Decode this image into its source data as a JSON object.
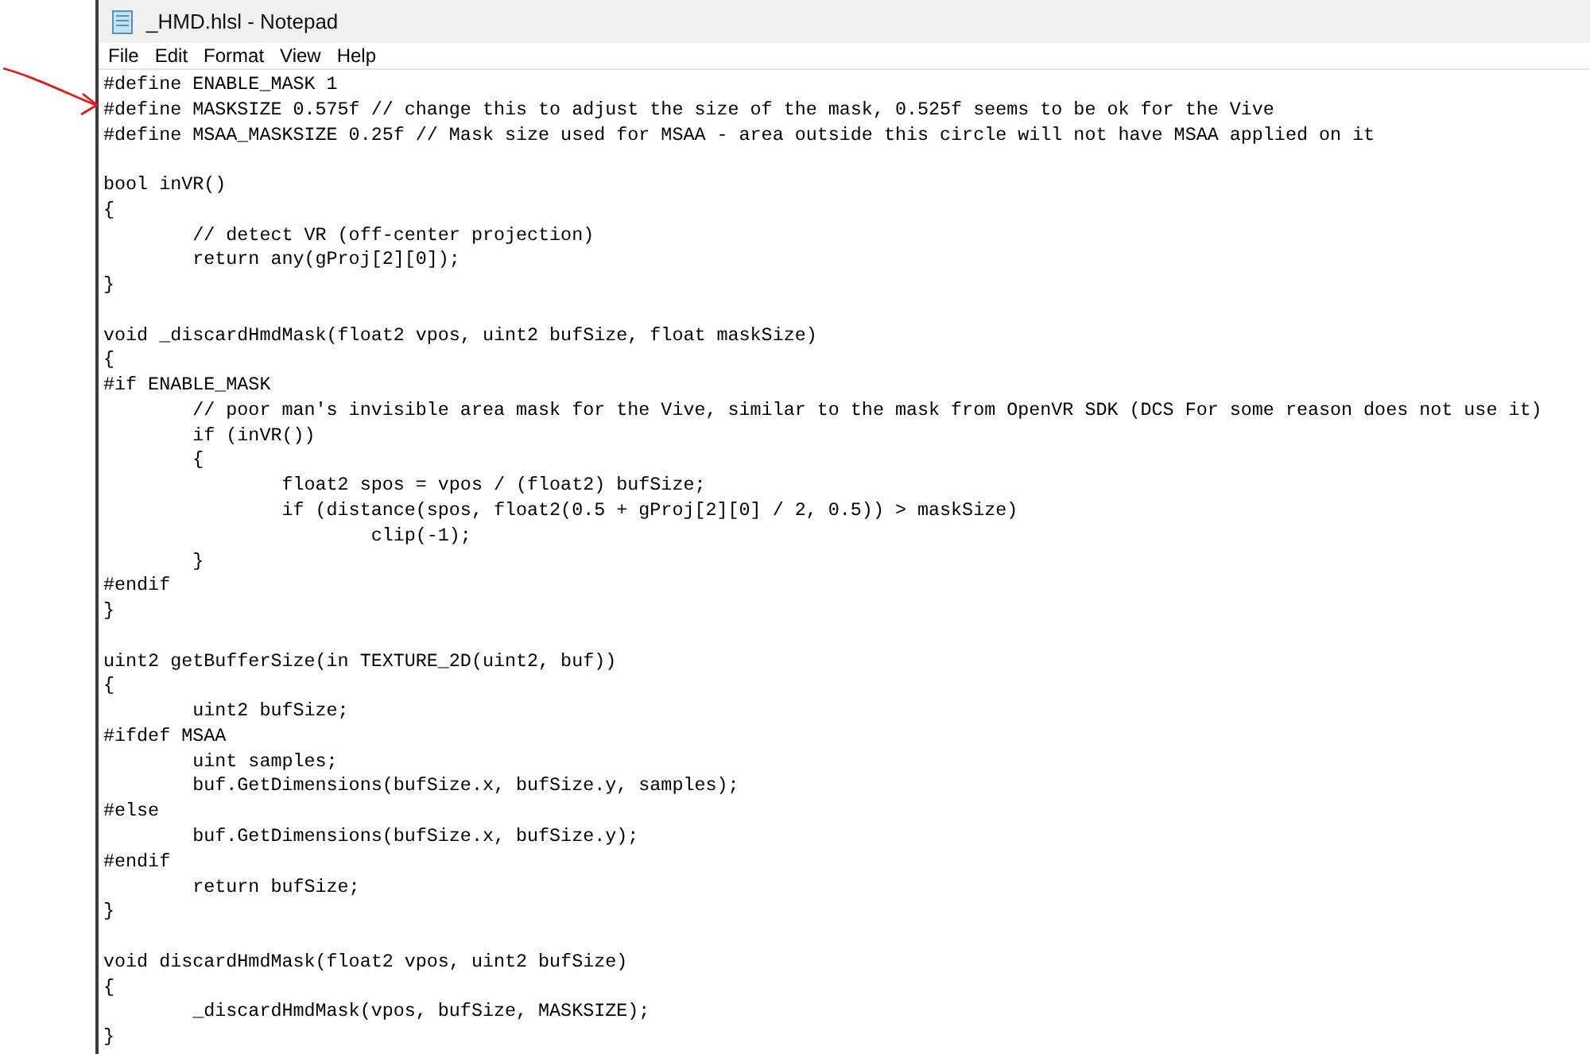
{
  "window": {
    "title": "_HMD.hlsl - Notepad"
  },
  "menu": [
    "File",
    "Edit",
    "Format",
    "View",
    "Help"
  ],
  "code_blocks": [
    [
      "#define ENABLE_MASK 1",
      "#define MASKSIZE 0.575f // change this to adjust the size of the mask, 0.525f seems to be ok for the Vive",
      "#define MSAA_MASKSIZE 0.25f // Mask size used for MSAA - area outside this circle will not have MSAA applied on it"
    ],
    [
      "bool inVR()",
      "{",
      "\t// detect VR (off-center projection)",
      "\treturn any(gProj[2][0]);",
      "}"
    ],
    [
      "void _discardHmdMask(float2 vpos, uint2 bufSize, float maskSize)",
      "{",
      "#if ENABLE_MASK",
      "\t// poor man's invisible area mask for the Vive, similar to the mask from OpenVR SDK (DCS For some reason does not use it)",
      "\tif (inVR())",
      "\t{",
      "\t\tfloat2 spos = vpos / (float2) bufSize;",
      "\t\tif (distance(spos, float2(0.5 + gProj[2][0] / 2, 0.5)) > maskSize)",
      "\t\t\tclip(-1);",
      "\t}",
      "#endif",
      "}"
    ],
    [
      "uint2 getBufferSize(in TEXTURE_2D(uint2, buf))",
      "{",
      "\tuint2 bufSize;",
      "#ifdef MSAA",
      "\tuint samples;",
      "\tbuf.GetDimensions(bufSize.x, bufSize.y, samples);",
      "#else",
      "\tbuf.GetDimensions(bufSize.x, bufSize.y);",
      "#endif",
      "\treturn bufSize;",
      "}"
    ],
    [
      "void discardHmdMask(float2 vpos, uint2 bufSize)",
      "{",
      "\t_discardHmdMask(vpos, bufSize, MASKSIZE);",
      "}"
    ]
  ]
}
